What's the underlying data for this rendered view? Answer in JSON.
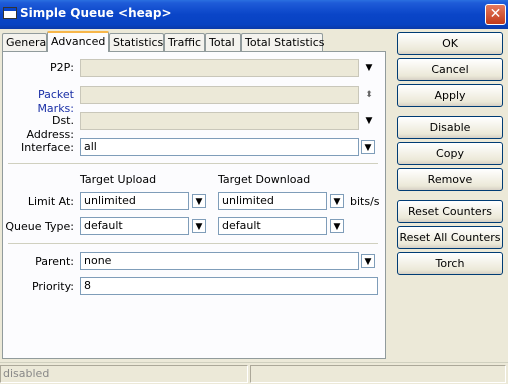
{
  "window": {
    "title": "Simple Queue <heap>",
    "close_glyph": "✕"
  },
  "tabs": [
    {
      "label": "General"
    },
    {
      "label": "Advanced"
    },
    {
      "label": "Statistics"
    },
    {
      "label": "Traffic"
    },
    {
      "label": "Total"
    },
    {
      "label": "Total Statistics"
    }
  ],
  "form": {
    "p2p": {
      "label": "P2P:",
      "value": ""
    },
    "packet_marks": {
      "label": "Packet Marks:",
      "value": ""
    },
    "dst_address": {
      "label": "Dst. Address:",
      "value": ""
    },
    "interface": {
      "label": "Interface:",
      "value": "all"
    },
    "columns": {
      "upload": "Target Upload",
      "download": "Target Download"
    },
    "limit_at": {
      "label": "Limit At:",
      "upload": "unlimited",
      "download": "unlimited",
      "unit": "bits/s"
    },
    "queue_type": {
      "label": "Queue Type:",
      "upload": "default",
      "download": "default"
    },
    "parent": {
      "label": "Parent:",
      "value": "none"
    },
    "priority": {
      "label": "Priority:",
      "value": "8"
    }
  },
  "buttons": {
    "ok": "OK",
    "cancel": "Cancel",
    "apply": "Apply",
    "disable": "Disable",
    "copy": "Copy",
    "remove": "Remove",
    "reset_counters": "Reset Counters",
    "reset_all_counters": "Reset All Counters",
    "torch": "Torch"
  },
  "glyphs": {
    "down": "▼",
    "updown": "⬍",
    "box_down": "▼"
  },
  "status": {
    "state": "disabled",
    "extra": ""
  }
}
